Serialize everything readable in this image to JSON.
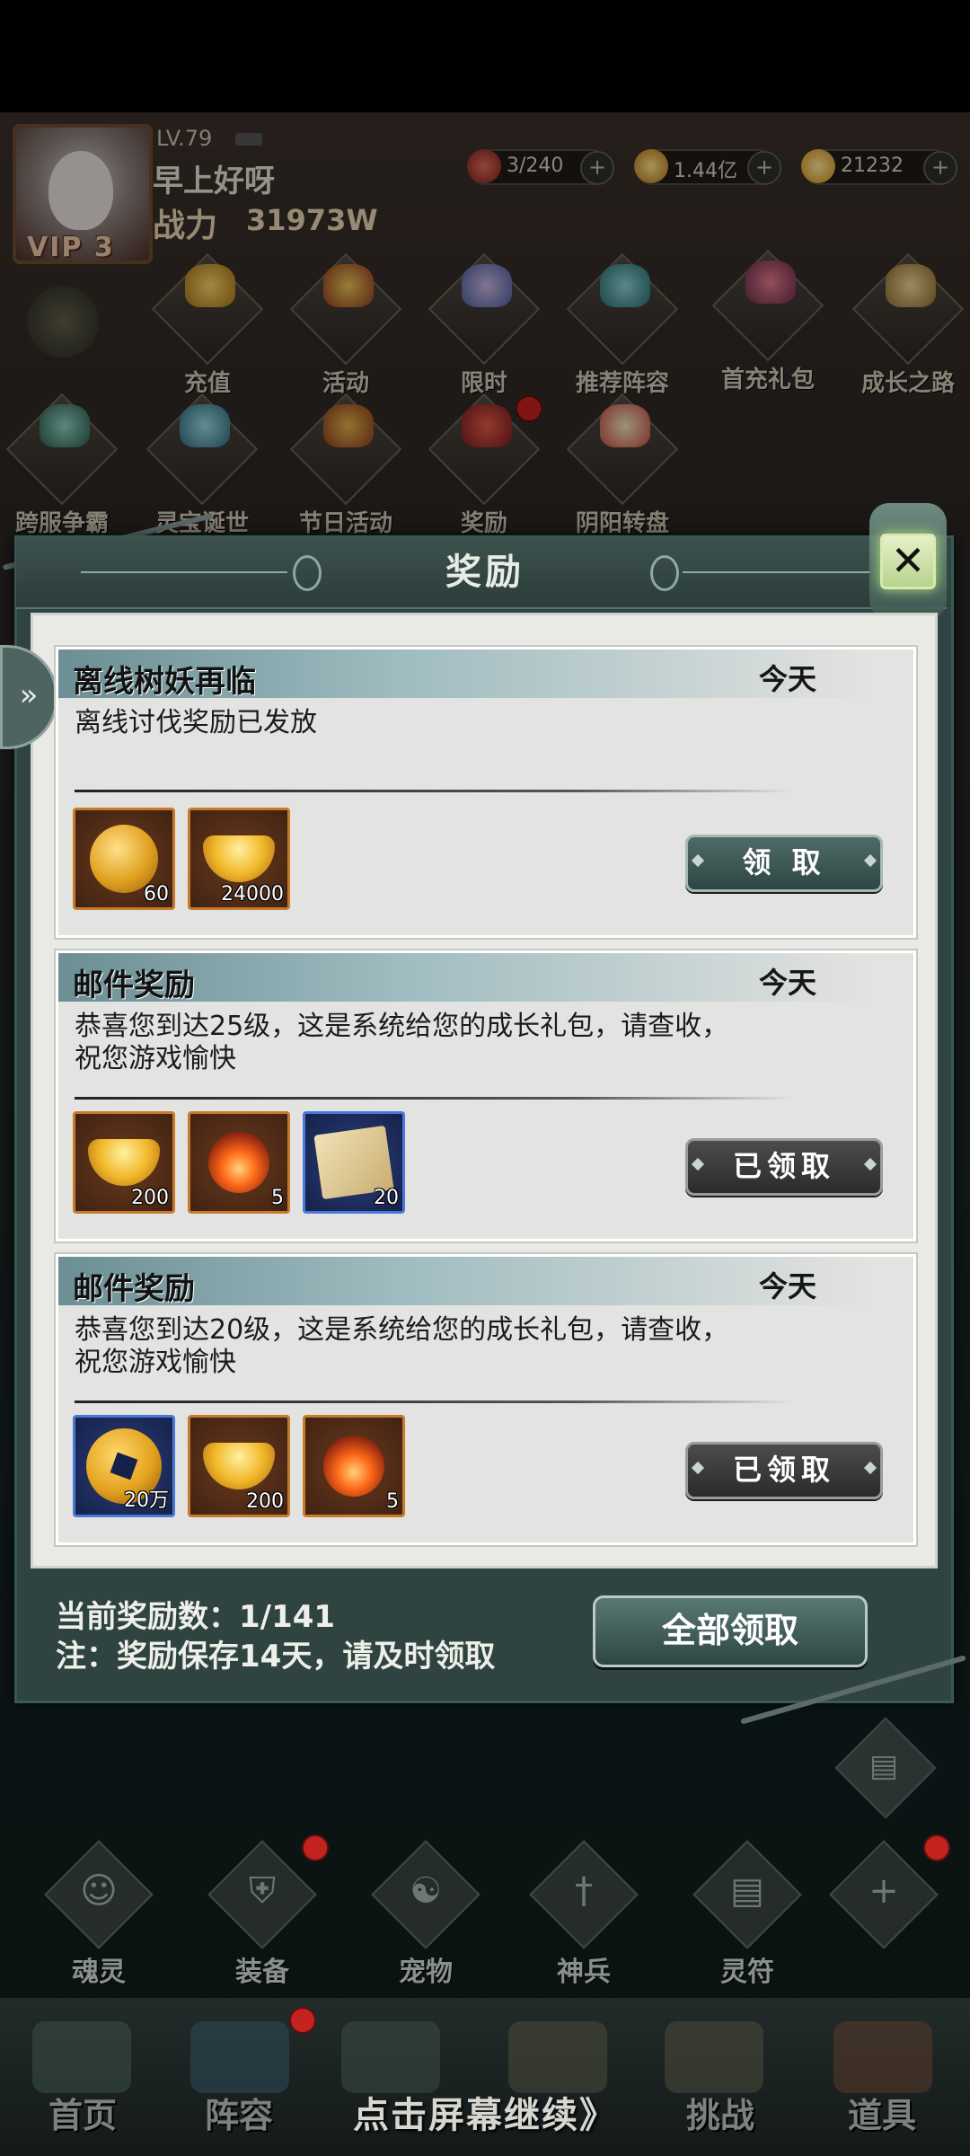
{
  "player": {
    "level": "LV.79",
    "name": "早上好呀",
    "power_label": "战力",
    "power_value": "31973W",
    "vip": "VIP 3"
  },
  "resources": [
    {
      "icon": "stamina-icon",
      "value": "3/240"
    },
    {
      "icon": "gold-coin-icon",
      "value": "1.44亿"
    },
    {
      "icon": "ingot-icon",
      "value": "21232"
    }
  ],
  "activities_row1": [
    "充值",
    "活动",
    "限时",
    "推荐阵容",
    "首充礼包",
    "成长之路"
  ],
  "activities_row2": [
    "跨服争霸",
    "灵宝诞世",
    "节日活动",
    "奖励",
    "阴阳转盘"
  ],
  "modal": {
    "title": "奖励",
    "close_symbol": "✕"
  },
  "mails": [
    {
      "title": "离线树妖再临",
      "date": "今天",
      "text": "离线讨伐奖励已发放",
      "items": [
        {
          "icon": "coin-icon",
          "count": "60"
        },
        {
          "icon": "gold-ingot-icon",
          "count": "24000"
        }
      ],
      "button": "领 取",
      "claimed": false
    },
    {
      "title": "邮件奖励",
      "date": "今天",
      "text": "恭喜您到达25级，这是系统给您的成长礼包，请查收，祝您游戏愉快",
      "items": [
        {
          "icon": "gold-ingot-icon",
          "count": "200"
        },
        {
          "icon": "fire-orb-icon",
          "count": "5"
        },
        {
          "icon": "scroll-icon",
          "count": "20"
        }
      ],
      "button": "已领取",
      "claimed": true
    },
    {
      "title": "邮件奖励",
      "date": "今天",
      "text": "恭喜您到达20级，这是系统给您的成长礼包，请查收，祝您游戏愉快",
      "items": [
        {
          "icon": "copper-coin-icon",
          "count": "20万"
        },
        {
          "icon": "gold-ingot-icon",
          "count": "200"
        },
        {
          "icon": "fire-orb-icon",
          "count": "5"
        }
      ],
      "button": "已领取",
      "claimed": true
    }
  ],
  "footer": {
    "count_text": "当前奖励数：1/141",
    "note_text": "注：奖励保存14天，请及时领取",
    "claim_all": "全部领取"
  },
  "bottom_icons": [
    "魂灵",
    "装备",
    "宠物",
    "神兵",
    "灵符"
  ],
  "bottom_icon_symbols": [
    "☺",
    "⛨",
    "☯",
    "†",
    "▤",
    "+"
  ],
  "nav": [
    "首页",
    "阵容",
    "挑战",
    "道具"
  ],
  "continue_hint": "点击屏幕继续》",
  "colors": {
    "accent": "#2e4643",
    "card_header": "#9fbcc0",
    "item_orange": "#c87a2b",
    "item_blue": "#4a78d8",
    "red_dot": "#c4221f"
  }
}
